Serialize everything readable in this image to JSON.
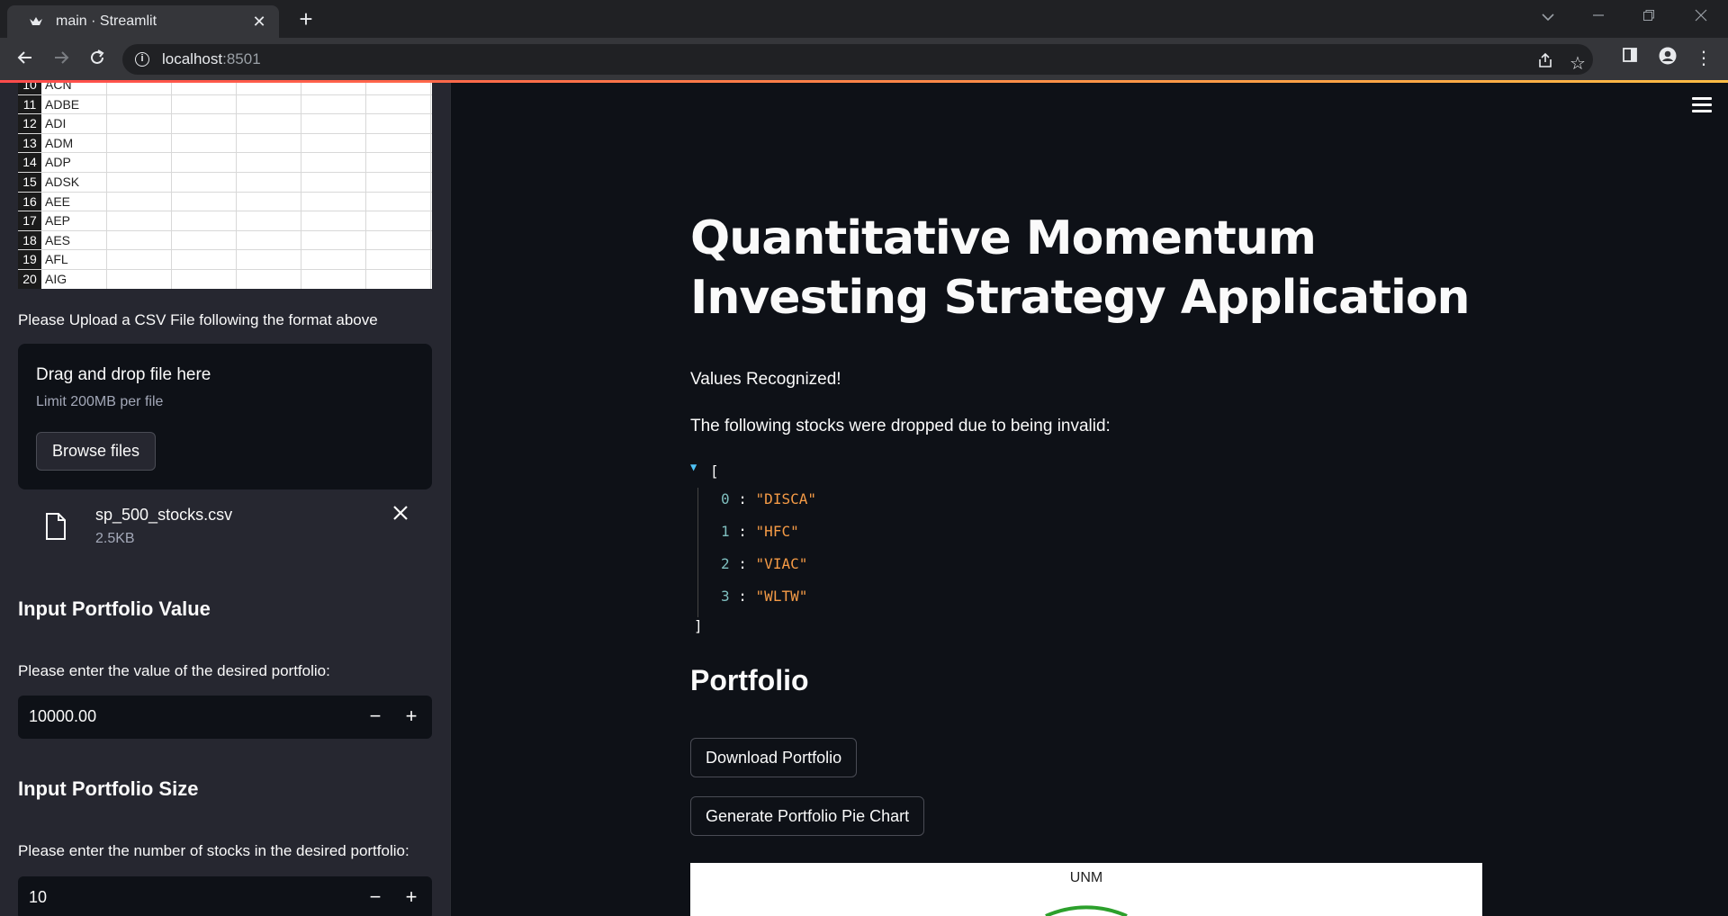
{
  "browser": {
    "tab_title": "main · Streamlit",
    "new_tab": "+",
    "url_host": "localhost",
    "url_port": ":8501"
  },
  "sidebar": {
    "table_rows": [
      {
        "num": "10",
        "ticker": "ACN"
      },
      {
        "num": "11",
        "ticker": "ADBE"
      },
      {
        "num": "12",
        "ticker": "ADI"
      },
      {
        "num": "13",
        "ticker": "ADM"
      },
      {
        "num": "14",
        "ticker": "ADP"
      },
      {
        "num": "15",
        "ticker": "ADSK"
      },
      {
        "num": "16",
        "ticker": "AEE"
      },
      {
        "num": "17",
        "ticker": "AEP"
      },
      {
        "num": "18",
        "ticker": "AES"
      },
      {
        "num": "19",
        "ticker": "AFL"
      },
      {
        "num": "20",
        "ticker": "AIG"
      }
    ],
    "upload_prompt": "Please Upload a CSV File following the format above",
    "uploader": {
      "title": "Drag and drop file here",
      "limit": "Limit 200MB per file",
      "browse_label": "Browse files"
    },
    "file": {
      "name": "sp_500_stocks.csv",
      "size": "2.5KB"
    },
    "portfolio_value": {
      "heading": "Input Portfolio Value",
      "label": "Please enter the value of the desired portfolio:",
      "value": "10000.00"
    },
    "portfolio_size": {
      "heading": "Input Portfolio Size",
      "label": "Please enter the number of stocks in the desired portfolio:",
      "value": "10"
    },
    "stepper_minus": "−",
    "stepper_plus": "+"
  },
  "main": {
    "title": "Quantitative Momentum Investing Strategy Application",
    "recognized": "Values Recognized!",
    "dropped_text": "The following stocks were dropped due to being invalid:",
    "dropped": [
      "\"DISCA\"",
      "\"HFC\"",
      "\"VIAC\"",
      "\"WLTW\""
    ],
    "json_open": "[",
    "json_close": "]",
    "portfolio_heading": "Portfolio",
    "download_label": "Download Portfolio",
    "pie_label": "Generate Portfolio Pie Chart",
    "chart_title": "UNM"
  },
  "colors": {
    "accent_start": "#ff4b4b",
    "accent_end": "#ffbd45",
    "json_value": "#f59b46"
  }
}
